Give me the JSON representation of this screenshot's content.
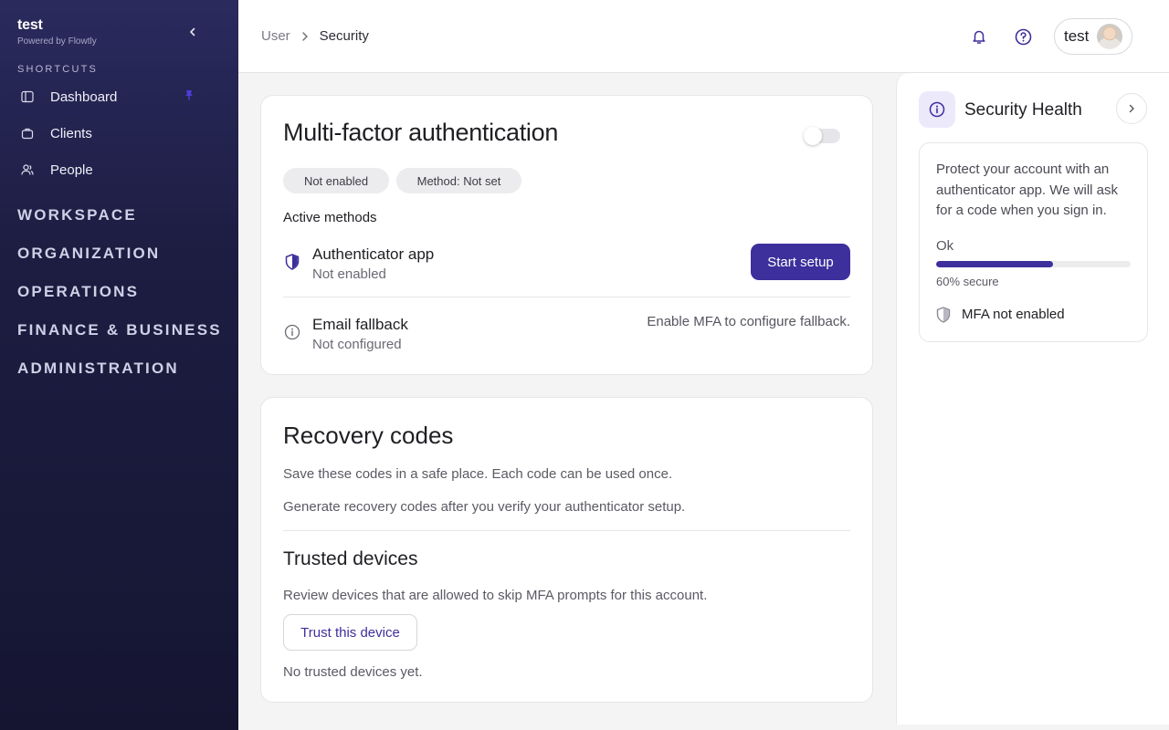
{
  "sidebar": {
    "brand_name": "test",
    "brand_sub": "Powered by Flowtly",
    "section_label": "SHORTCUTS",
    "shortcuts": [
      {
        "label": "Dashboard",
        "icon": "panel-icon"
      },
      {
        "label": "Clients",
        "icon": "briefcase-icon"
      },
      {
        "label": "People",
        "icon": "users-icon"
      }
    ],
    "groups": [
      "WORKSPACE",
      "ORGANIZATION",
      "OPERATIONS",
      "FINANCE & BUSINESS",
      "ADMINISTRATION"
    ]
  },
  "topbar": {
    "breadcrumb": [
      "User",
      "Security"
    ],
    "user_name": "test"
  },
  "mfa": {
    "title": "Multi-factor authentication",
    "toggle_on": false,
    "pills": [
      "Not enabled",
      "Method: Not set"
    ],
    "active_methods_label": "Active methods",
    "authenticator": {
      "title": "Authenticator app",
      "status": "Not enabled",
      "button": "Start setup"
    },
    "email": {
      "title": "Email fallback",
      "status": "Not configured",
      "note": "Enable MFA to configure fallback."
    }
  },
  "recovery": {
    "title": "Recovery codes",
    "line1": "Save these codes in a safe place. Each code can be used once.",
    "line2": "Generate recovery codes after you verify your authenticator setup.",
    "trusted_title": "Trusted devices",
    "trusted_desc": "Review devices that are allowed to skip MFA prompts for this account.",
    "trust_button": "Trust this device",
    "empty_text": "No trusted devices yet."
  },
  "health": {
    "title": "Security Health",
    "description": "Protect your account with an authenticator app. We will ask for a code when you sign in.",
    "status": "Ok",
    "progress_percent": 60,
    "secure_label": "60% secure",
    "mfa_label": "MFA not enabled"
  },
  "colors": {
    "accent": "#3d2f9c",
    "sidebar_top": "#2a2a5e",
    "sidebar_bottom": "#151532"
  }
}
